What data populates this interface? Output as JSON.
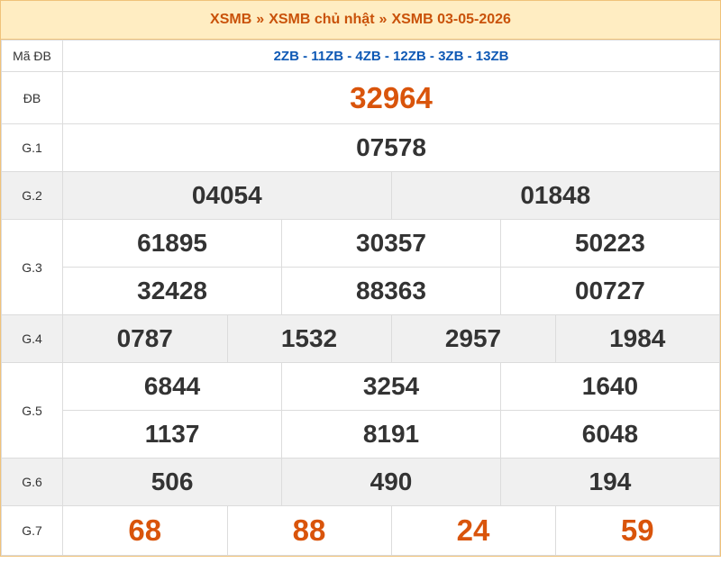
{
  "breadcrumb": {
    "items": [
      "XSMB",
      "XSMB chủ nhật",
      "XSMB 03-05-2026"
    ],
    "separator": "»"
  },
  "labels": {
    "code": "Mã ĐB",
    "db": "ĐB",
    "g1": "G.1",
    "g2": "G.2",
    "g3": "G.3",
    "g4": "G.4",
    "g5": "G.5",
    "g6": "G.6",
    "g7": "G.7"
  },
  "code_value": "2ZB - 11ZB - 4ZB - 12ZB - 3ZB - 13ZB",
  "prizes": {
    "db": [
      "32964"
    ],
    "g1": [
      "07578"
    ],
    "g2": [
      "04054",
      "01848"
    ],
    "g3": [
      "61895",
      "30357",
      "50223",
      "32428",
      "88363",
      "00727"
    ],
    "g4": [
      "0787",
      "1532",
      "2957",
      "1984"
    ],
    "g5": [
      "6844",
      "3254",
      "1640",
      "1137",
      "8191",
      "6048"
    ],
    "g6": [
      "506",
      "490",
      "194"
    ],
    "g7": [
      "68",
      "88",
      "24",
      "59"
    ]
  },
  "colors": {
    "accent": "#c9520a",
    "special": "#d9540b",
    "code": "#0f59b5",
    "header_bg": "#ffedc2"
  }
}
